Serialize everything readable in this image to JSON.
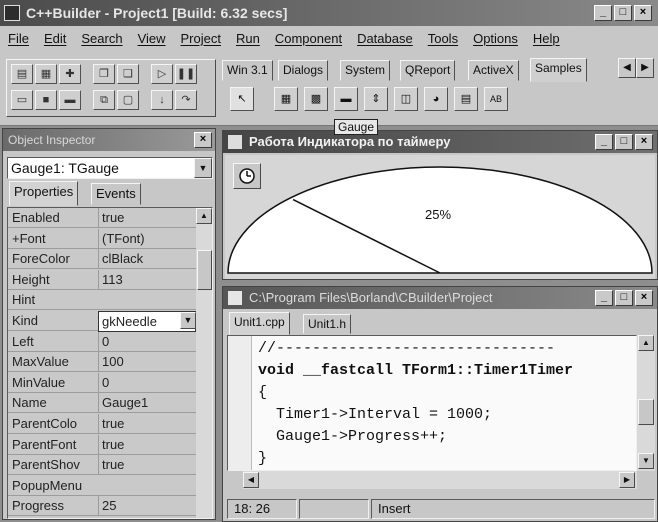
{
  "main_window": {
    "title": "C++Builder - Project1 [Build: 6.32 secs]",
    "buttons": [
      "_",
      "□",
      "×"
    ]
  },
  "menu": [
    "File",
    "Edit",
    "Search",
    "View",
    "Project",
    "Run",
    "Component",
    "Database",
    "Tools",
    "Options",
    "Help"
  ],
  "palette": {
    "tabs": [
      "Win 3.1",
      "Dialogs",
      "System",
      "QReport",
      "ActiveX",
      "Samples"
    ],
    "active_tab": "Samples",
    "tooltip": "Gauge"
  },
  "inspector": {
    "title": "Object Inspector",
    "selected_object": "Gauge1: TGauge",
    "tabs": [
      "Properties",
      "Events"
    ],
    "properties": [
      {
        "name": "Enabled",
        "value": "true"
      },
      {
        "name": "+Font",
        "value": "(TFont)"
      },
      {
        "name": "ForeColor",
        "value": "clBlack"
      },
      {
        "name": "Height",
        "value": "113"
      },
      {
        "name": "Hint",
        "value": ""
      },
      {
        "name": "Kind",
        "value": "gkNeedle",
        "selected": true
      },
      {
        "name": "Left",
        "value": "0"
      },
      {
        "name": "MaxValue",
        "value": "100"
      },
      {
        "name": "MinValue",
        "value": "0"
      },
      {
        "name": "Name",
        "value": "Gauge1"
      },
      {
        "name": "ParentColo",
        "value": "true"
      },
      {
        "name": "ParentFont",
        "value": "true"
      },
      {
        "name": "ParentShov",
        "value": "true"
      },
      {
        "name": "PopupMenu",
        "value": ""
      },
      {
        "name": "Progress",
        "value": "25"
      }
    ]
  },
  "gauge_form": {
    "title": "Работа Индикатора по таймеру",
    "gauge_label": "25%",
    "progress_percent": 25,
    "buttons": [
      "_",
      "□",
      "×"
    ]
  },
  "editor": {
    "title": "C:\\Program Files\\Borland\\CBuilder\\Project",
    "tabs": [
      "Unit1.cpp",
      "Unit1.h"
    ],
    "code": [
      "//-------------------------------",
      "void __fastcall TForm1::Timer1Timer",
      "{",
      "  Timer1->Interval = 1000;",
      "  Gauge1->Progress++;",
      "}"
    ],
    "status": {
      "position": "18: 26",
      "modified": "",
      "mode": "Insert"
    },
    "buttons": [
      "_",
      "□",
      "×"
    ]
  }
}
